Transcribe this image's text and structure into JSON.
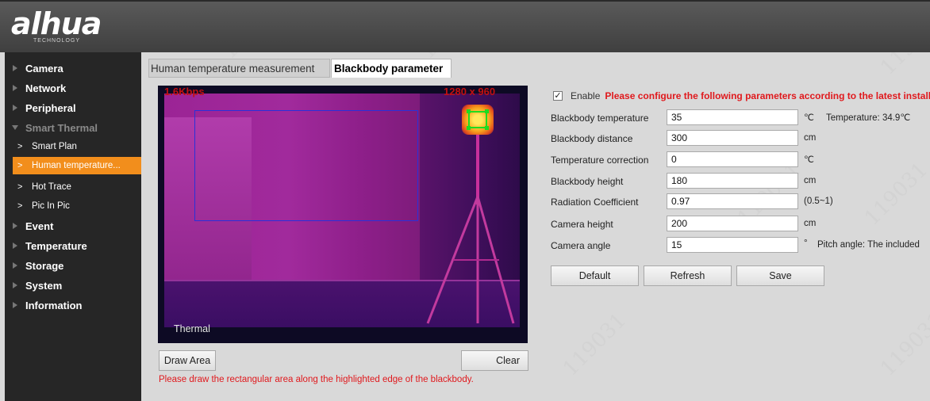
{
  "header": {
    "logo_text": "alhua",
    "logo_subtext": "TECHNOLOGY"
  },
  "sidebar": {
    "items": [
      {
        "label": "Camera",
        "expanded": false
      },
      {
        "label": "Network",
        "expanded": false
      },
      {
        "label": "Peripheral",
        "expanded": false
      },
      {
        "label": "Smart Thermal",
        "expanded": true
      },
      {
        "label": "Event",
        "expanded": false
      },
      {
        "label": "Temperature",
        "expanded": false
      },
      {
        "label": "Storage",
        "expanded": false
      },
      {
        "label": "System",
        "expanded": false
      },
      {
        "label": "Information",
        "expanded": false
      }
    ],
    "sub_items": [
      {
        "label": "Smart Plan",
        "active": false
      },
      {
        "label": "Human temperature...",
        "active": true
      },
      {
        "label": "Hot Trace",
        "active": false
      },
      {
        "label": "Pic In Pic",
        "active": false
      }
    ],
    "active_color": "#f28e1c"
  },
  "tabs": [
    {
      "label": "Human temperature measurement",
      "active": false
    },
    {
      "label": "Blackbody parameter",
      "active": true
    }
  ],
  "video": {
    "osd_left": "1.6Kbps",
    "osd_right": "1280 x 960",
    "channel_label": "Thermal"
  },
  "video_buttons": {
    "draw_area": "Draw Area",
    "clear": "Clear"
  },
  "hint_text": "Please draw the rectangular area along the highlighted edge of the blackbody.",
  "form": {
    "enable_checked": true,
    "enable_label": "Enable",
    "enable_note": "Please configure the following parameters according to the latest installat",
    "fields": [
      {
        "label": "Blackbody temperature",
        "value": "35",
        "unit": "℃",
        "extra": "Temperature: 34.9℃"
      },
      {
        "label": "Blackbody distance",
        "value": "300",
        "unit": "cm",
        "extra": ""
      },
      {
        "label": "Temperature correction",
        "value": "0",
        "unit": "℃",
        "extra": ""
      },
      {
        "label": "Blackbody height",
        "value": "180",
        "unit": "cm",
        "extra": ""
      },
      {
        "label": "Radiation Coefficient",
        "value": "0.97",
        "unit": "(0.5~1)",
        "extra": ""
      },
      {
        "label": "Camera height",
        "value": "200",
        "unit": "cm",
        "extra": ""
      },
      {
        "label": "Camera angle",
        "value": "15",
        "unit": "°",
        "extra": "Pitch angle: The included"
      }
    ],
    "buttons": {
      "default": "Default",
      "refresh": "Refresh",
      "save": "Save"
    }
  },
  "watermark_text": "119031",
  "colors": {
    "alert_red": "#e0191d",
    "header": "#4a4a4a",
    "sidebar": "#262626",
    "selection_green": "#1fdc1f"
  }
}
